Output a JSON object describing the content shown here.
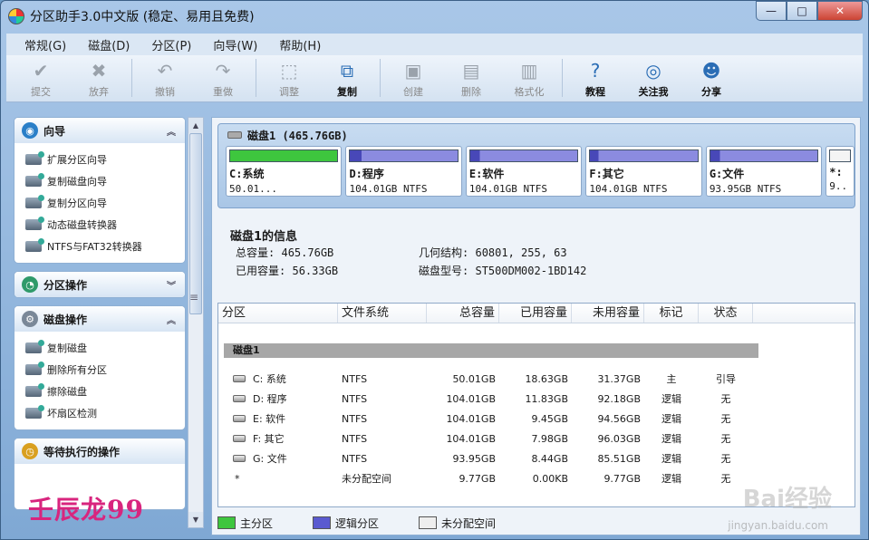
{
  "window": {
    "title": "分区助手3.0中文版 (稳定、易用且免费)",
    "min": "—",
    "max": "□",
    "close": "✕"
  },
  "menu": [
    "常规(G)",
    "磁盘(D)",
    "分区(P)",
    "向导(W)",
    "帮助(H)"
  ],
  "toolbar": [
    {
      "label": "提交",
      "icon": "check-icon",
      "glyph": "✔",
      "enabled": false
    },
    {
      "label": "放弃",
      "icon": "cancel-icon",
      "glyph": "✖",
      "enabled": false
    },
    {
      "label": "撤销",
      "icon": "undo-icon",
      "glyph": "↶",
      "enabled": false
    },
    {
      "label": "重做",
      "icon": "redo-icon",
      "glyph": "↷",
      "enabled": false
    },
    {
      "label": "调整",
      "icon": "resize-disk-icon",
      "glyph": "⬚",
      "enabled": false
    },
    {
      "label": "复制",
      "icon": "copy-disk-icon",
      "glyph": "⧉",
      "enabled": true
    },
    {
      "label": "创建",
      "icon": "create-disk-icon",
      "glyph": "▣",
      "enabled": false
    },
    {
      "label": "删除",
      "icon": "delete-disk-icon",
      "glyph": "▤",
      "enabled": false
    },
    {
      "label": "格式化",
      "icon": "format-disk-icon",
      "glyph": "▥",
      "enabled": false
    },
    {
      "label": "教程",
      "icon": "help-icon",
      "glyph": "?",
      "enabled": true
    },
    {
      "label": "关注我",
      "icon": "weibo-icon",
      "glyph": "◎",
      "enabled": true
    },
    {
      "label": "分享",
      "icon": "share-users-icon",
      "glyph": "☻",
      "enabled": true
    }
  ],
  "sidebar": {
    "wizard": {
      "title": "向导",
      "items": [
        "扩展分区向导",
        "复制磁盘向导",
        "复制分区向导",
        "动态磁盘转换器",
        "NTFS与FAT32转换器"
      ]
    },
    "partition_ops": {
      "title": "分区操作"
    },
    "disk_ops": {
      "title": "磁盘操作",
      "items": [
        "复制磁盘",
        "删除所有分区",
        "擦除磁盘",
        "坏扇区检测"
      ]
    },
    "pending": {
      "title": "等待执行的操作"
    },
    "signature": "壬辰龙99"
  },
  "disk": {
    "header": "磁盘1 (465.76GB)",
    "partitions": [
      {
        "name": "C:系统",
        "info": "50.01...",
        "type": "primary",
        "used_fraction": 0.37
      },
      {
        "name": "D:程序",
        "info": "104.01GB NTFS",
        "type": "logical",
        "used_fraction": 0.11
      },
      {
        "name": "E:软件",
        "info": "104.01GB NTFS",
        "type": "logical",
        "used_fraction": 0.09
      },
      {
        "name": "F:其它",
        "info": "104.01GB NTFS",
        "type": "logical",
        "used_fraction": 0.08
      },
      {
        "name": "G:文件",
        "info": "93.95GB NTFS",
        "type": "logical",
        "used_fraction": 0.09
      },
      {
        "name": "*:",
        "info": "9..",
        "type": "unallocated",
        "used_fraction": 0
      }
    ]
  },
  "info": {
    "title": "磁盘1的信息",
    "total_label": "总容量:",
    "total": "465.76GB",
    "used_label": "已用容量:",
    "used": "56.33GB",
    "geometry_label": "几何结构:",
    "geometry": "60801, 255, 63",
    "model_label": "磁盘型号:",
    "model": "ST500DM002-1BD142"
  },
  "table": {
    "headers": [
      "分区",
      "文件系统",
      "总容量",
      "已用容量",
      "未用容量",
      "标记",
      "状态"
    ],
    "group": "磁盘1",
    "rows": [
      [
        "C: 系统",
        "NTFS",
        "50.01GB",
        "18.63GB",
        "31.37GB",
        "主",
        "引导"
      ],
      [
        "D: 程序",
        "NTFS",
        "104.01GB",
        "11.83GB",
        "92.18GB",
        "逻辑",
        "无"
      ],
      [
        "E: 软件",
        "NTFS",
        "104.01GB",
        "9.45GB",
        "94.56GB",
        "逻辑",
        "无"
      ],
      [
        "F: 其它",
        "NTFS",
        "104.01GB",
        "7.98GB",
        "96.03GB",
        "逻辑",
        "无"
      ],
      [
        "G: 文件",
        "NTFS",
        "93.95GB",
        "8.44GB",
        "85.51GB",
        "逻辑",
        "无"
      ],
      [
        "*",
        "未分配空间",
        "9.77GB",
        "0.00KB",
        "9.77GB",
        "逻辑",
        "无"
      ]
    ]
  },
  "legend": [
    {
      "label": "主分区",
      "color": "#3ec63e"
    },
    {
      "label": "逻辑分区",
      "color": "#5a5ad0"
    },
    {
      "label": "未分配空间",
      "color": "#eeeeee"
    }
  ],
  "watermark": {
    "brand": "Bai经验",
    "url": "jingyan.baidu.com"
  }
}
